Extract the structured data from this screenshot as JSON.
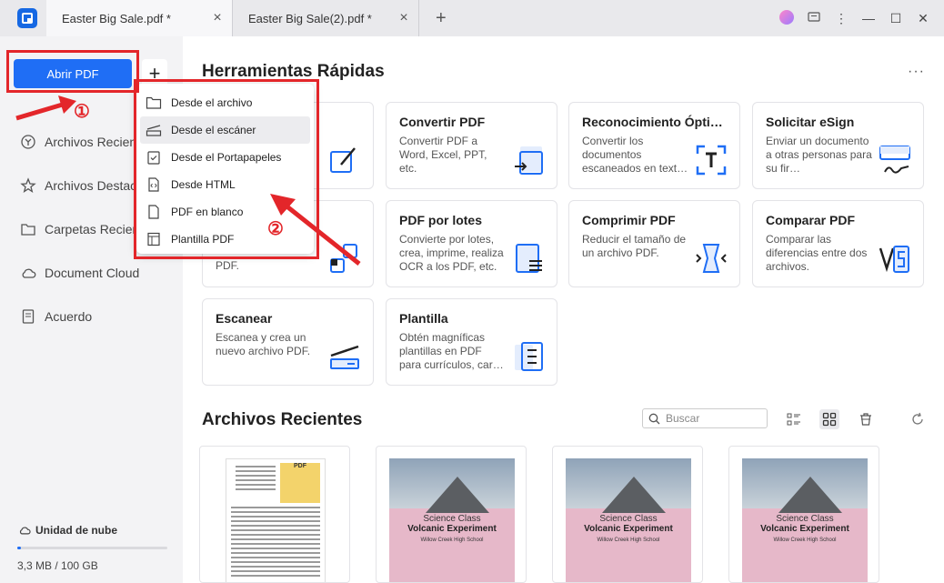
{
  "tabs": [
    {
      "label": "Easter Big Sale.pdf *",
      "active": true
    },
    {
      "label": "Easter Big Sale(2).pdf *",
      "active": false
    }
  ],
  "sidebar": {
    "open_label": "Abrir PDF",
    "add_label": "+",
    "items": [
      {
        "label": "Archivos Recientes",
        "icon": "clock-icon"
      },
      {
        "label": "Archivos Destacados",
        "icon": "star-icon"
      },
      {
        "label": "Carpetas Recientes",
        "icon": "folder-icon"
      },
      {
        "label": "Document Cloud",
        "icon": "cloud-icon"
      },
      {
        "label": "Acuerdo",
        "icon": "document-icon"
      }
    ],
    "cloud_label": "Unidad de nube",
    "storage": "3,3 MB / 100 GB",
    "storage_fraction": 3e-05
  },
  "dropdown": {
    "items": [
      {
        "label": "Desde el archivo",
        "icon": "folder-icon"
      },
      {
        "label": "Desde el escáner",
        "icon": "scanner-icon"
      },
      {
        "label": "Desde el Portapapeles",
        "icon": "clipboard-icon"
      },
      {
        "label": "Desde HTML",
        "icon": "html-icon"
      },
      {
        "label": "PDF en blanco",
        "icon": "blank-page-icon"
      },
      {
        "label": "Plantilla PDF",
        "icon": "template-icon"
      }
    ]
  },
  "annotations": {
    "one": "①",
    "two": "②"
  },
  "main": {
    "title": "Herramientas Rápidas",
    "more_label": "···",
    "cards": [
      {
        "title": "",
        "desc": "",
        "icon": "edit-icon"
      },
      {
        "title": "Convertir PDF",
        "desc": "Convertir PDF a Word, Excel, PPT, etc.",
        "icon": "convert-icon"
      },
      {
        "title": "Reconocimiento Óptic…",
        "desc": "Convertir los documentos escaneados en text…",
        "icon": "ocr-icon"
      },
      {
        "title": "Solicitar eSign",
        "desc": "Enviar un documento a otras personas para su fir…",
        "icon": "esign-icon"
      },
      {
        "title": "",
        "desc": "PDF.",
        "icon": "combine-icon"
      },
      {
        "title": "PDF por lotes",
        "desc": "Convierte por lotes, crea, imprime, realiza OCR a los PDF, etc.",
        "icon": "batch-icon"
      },
      {
        "title": "Comprimir PDF",
        "desc": "Reducir el tamaño de un archivo PDF.",
        "icon": "compress-icon"
      },
      {
        "title": "Comparar PDF",
        "desc": "Comparar las diferencias entre dos archivos.",
        "icon": "compare-icon"
      },
      {
        "title": "Escanear",
        "desc": "Escanea y crea un nuevo archivo PDF.",
        "icon": "scanner-icon"
      },
      {
        "title": "Plantilla",
        "desc": "Obtén magníficas plantillas en PDF para currículos, car…",
        "icon": "template-icon"
      }
    ],
    "recent_title": "Archivos Recientes",
    "search_placeholder": "Buscar",
    "thumbs": [
      {
        "type": "doc",
        "label": "PDF"
      },
      {
        "type": "cover",
        "line1": "Science Class",
        "line2": "Volcanic Experiment",
        "line3": "Willow Creek High School"
      },
      {
        "type": "cover",
        "line1": "Science Class",
        "line2": "Volcanic Experiment",
        "line3": "Willow Creek High School"
      },
      {
        "type": "cover",
        "line1": "Science Class",
        "line2": "Volcanic Experiment",
        "line3": "Willow Creek High School"
      }
    ]
  },
  "colors": {
    "accent": "#1f6ef5",
    "annotation": "#e3262a"
  }
}
